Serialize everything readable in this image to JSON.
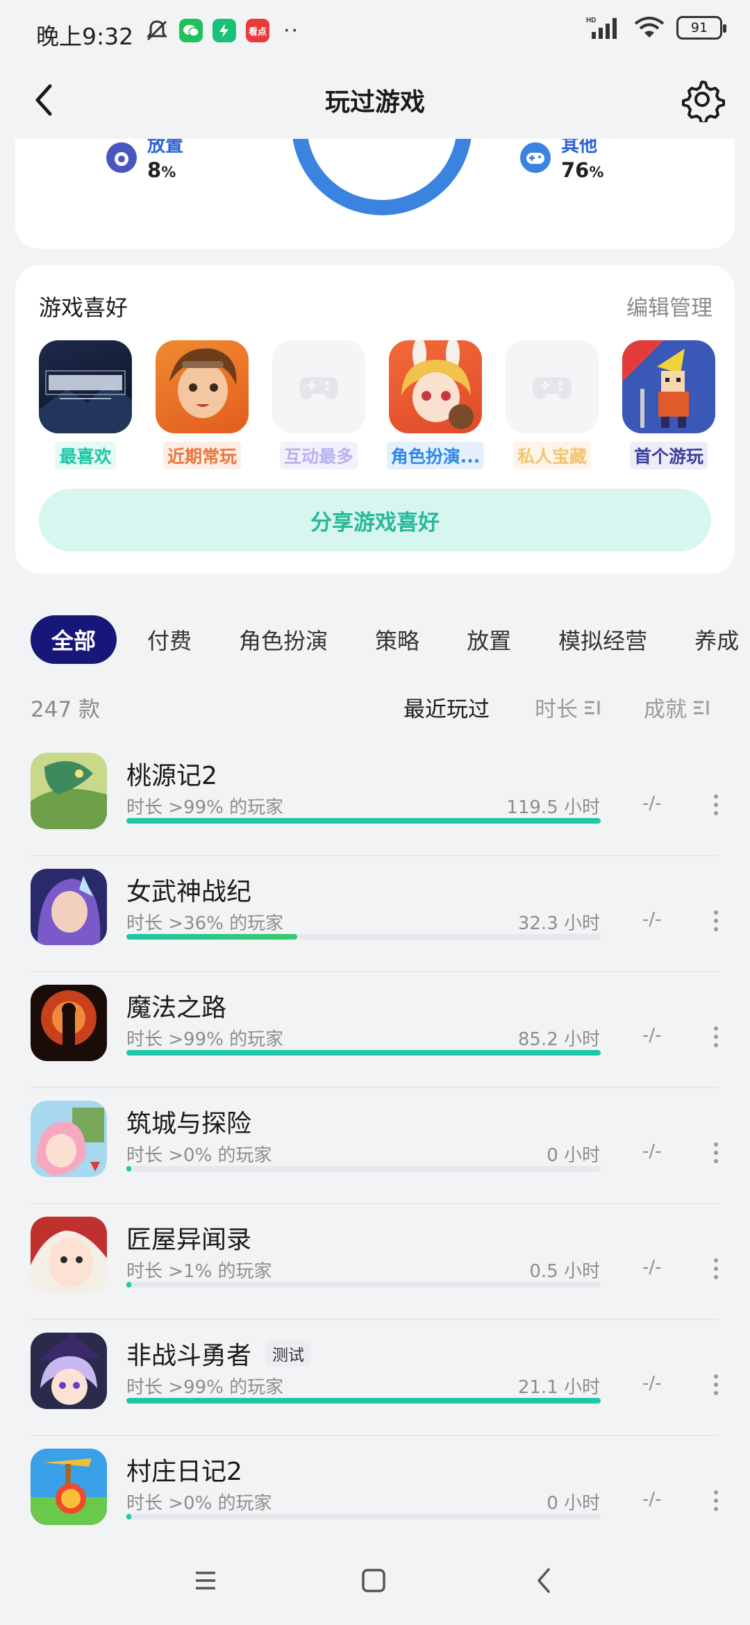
{
  "status_bar": {
    "time": "晚上9:32",
    "app_badge_label": "看点",
    "more_dots": "··",
    "signal_hd": "HD",
    "battery": "91"
  },
  "header": {
    "title": "玩过游戏"
  },
  "summary": {
    "items": [
      {
        "label": "放置",
        "value": "8",
        "unit": "%"
      },
      {
        "label": "其他",
        "value": "76",
        "unit": "%"
      }
    ]
  },
  "preferences": {
    "title": "游戏喜好",
    "edit_label": "编辑管理",
    "items": [
      {
        "label": "最喜欢",
        "label_color": "#1ec6a6",
        "label_bg": "#e6f9f4",
        "icon": "game-icon-qilu"
      },
      {
        "label": "近期常玩",
        "label_color": "#f0743a",
        "label_bg": "#fdeee6",
        "icon": "game-icon-character"
      },
      {
        "label": "互动最多",
        "label_color": "#b8b2ee",
        "label_bg": "#f3f2fc",
        "icon": "gamepad-placeholder-icon"
      },
      {
        "label": "角色扮演...",
        "label_color": "#2f87e8",
        "label_bg": "#e4f1fd",
        "icon": "game-icon-bunny-girl"
      },
      {
        "label": "私人宝藏",
        "label_color": "#f3c470",
        "label_bg": "#fdf6e8",
        "icon": "gamepad-placeholder-icon"
      },
      {
        "label": "首个游玩",
        "label_color": "#3b3e9c",
        "label_bg": "#ededf7",
        "icon": "game-icon-pixel-knight"
      }
    ],
    "share_label": "分享游戏喜好"
  },
  "tabs": [
    "全部",
    "付费",
    "角色扮演",
    "策略",
    "放置",
    "模拟经营",
    "养成"
  ],
  "list_header": {
    "count": "247 款",
    "sort_recent": "最近玩过",
    "sort_duration": "时长",
    "sort_achievement": "成就"
  },
  "games": [
    {
      "name": "桃源记2",
      "sub": "时长 >99% 的玩家",
      "hours": "119.5 小时",
      "ach": "-/-",
      "progress": 1.0,
      "tag": ""
    },
    {
      "name": "女武神战纪",
      "sub": "时长 >36% 的玩家",
      "hours": "32.3 小时",
      "ach": "-/-",
      "progress": 0.36,
      "tag": ""
    },
    {
      "name": "魔法之路",
      "sub": "时长 >99% 的玩家",
      "hours": "85.2 小时",
      "ach": "-/-",
      "progress": 1.0,
      "tag": ""
    },
    {
      "name": "筑城与探险",
      "sub": "时长 >0% 的玩家",
      "hours": "0 小时",
      "ach": "-/-",
      "progress": 0.01,
      "tag": ""
    },
    {
      "name": "匠屋异闻录",
      "sub": "时长 >1% 的玩家",
      "hours": "0.5 小时",
      "ach": "-/-",
      "progress": 0.01,
      "tag": ""
    },
    {
      "name": "非战斗勇者",
      "sub": "时长 >99% 的玩家",
      "hours": "21.1 小时",
      "ach": "-/-",
      "progress": 1.0,
      "tag": "测试"
    },
    {
      "name": "村庄日记2",
      "sub": "时长 >0% 的玩家",
      "hours": "0 小时",
      "ach": "-/-",
      "progress": 0.01,
      "tag": ""
    }
  ],
  "colors": {
    "accent": "#1ec6a6",
    "tab_active_bg": "#17177a",
    "donut": "#3a84e0"
  }
}
